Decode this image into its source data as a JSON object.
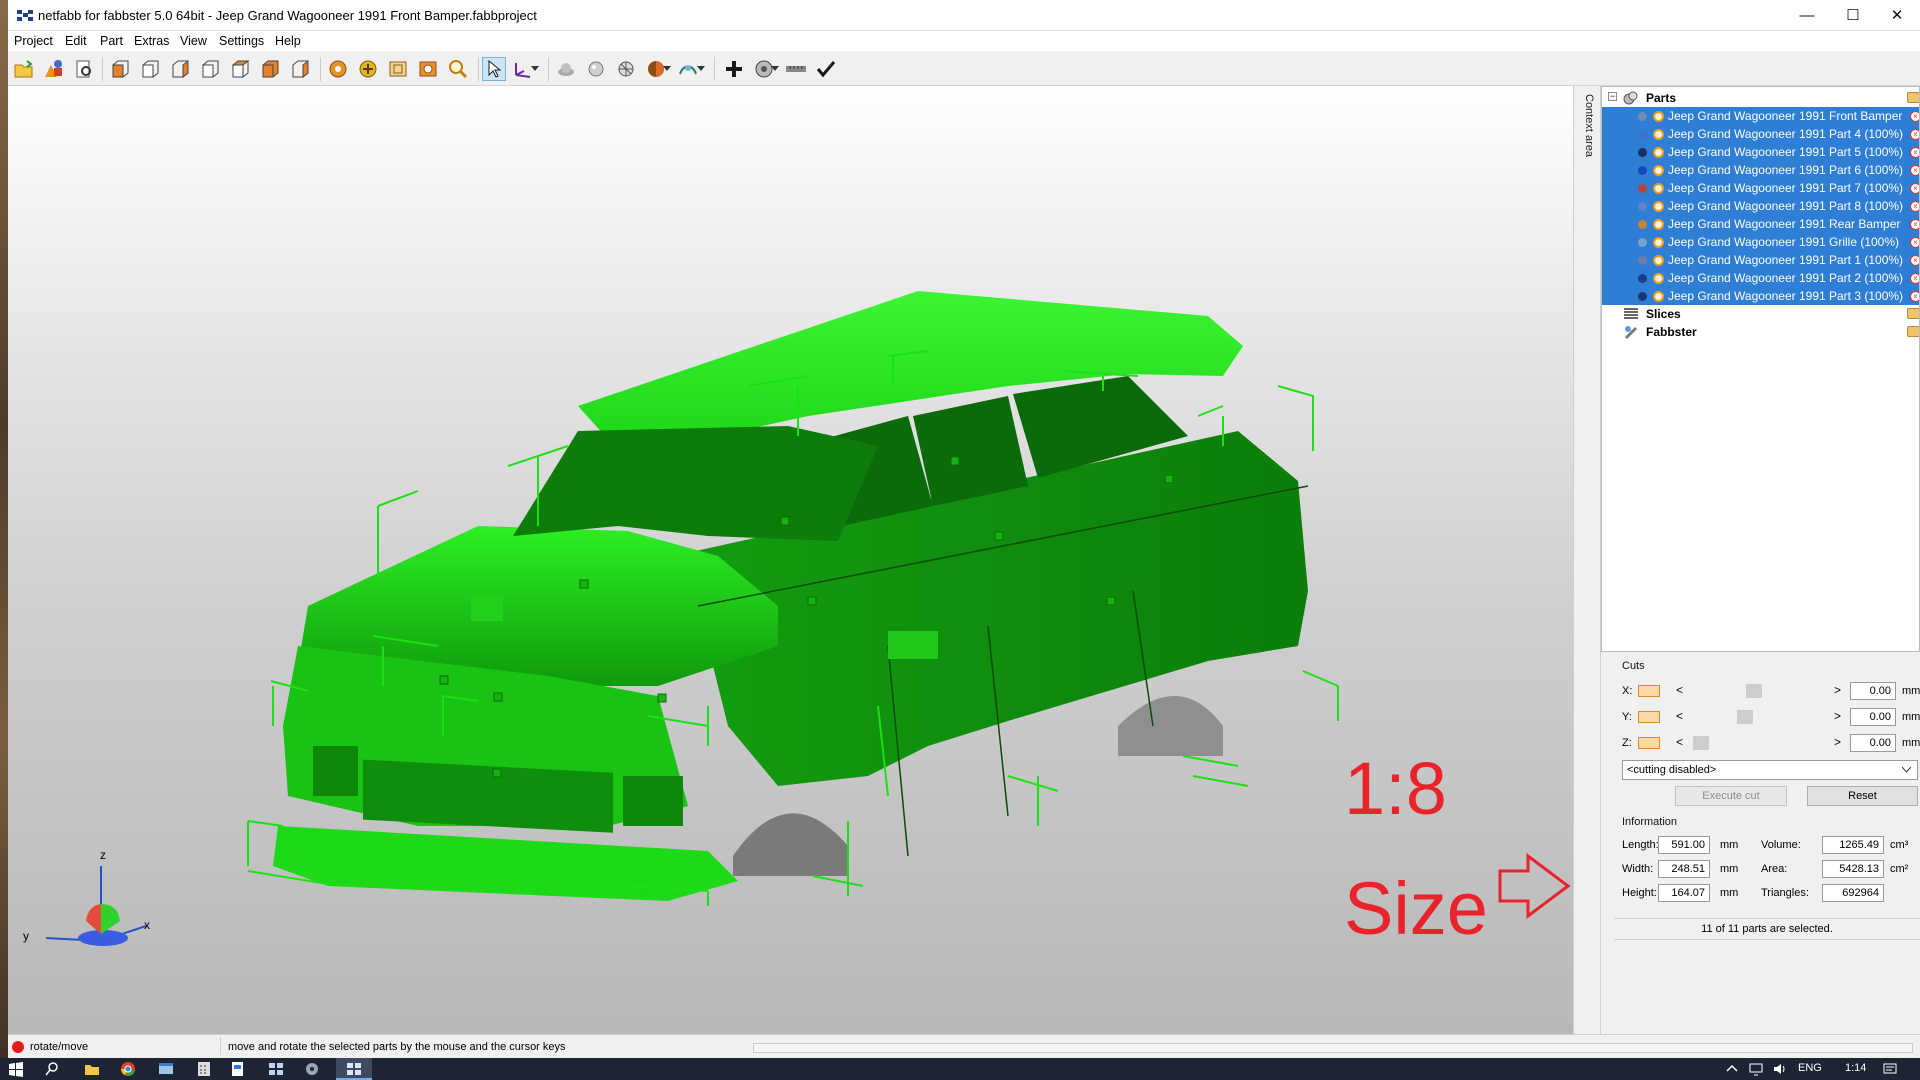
{
  "window": {
    "title": "netfabb for fabbster 5.0 64bit - Jeep Grand Wagooneer 1991 Front Bamper.fabbproject",
    "minimize": "—",
    "maximize": "☐",
    "close": "✕"
  },
  "menu": [
    "Project",
    "Edit",
    "Part",
    "Extras",
    "View",
    "Settings",
    "Help"
  ],
  "toolbar_icons": [
    "open-project",
    "add-part",
    "print-preview",
    "view-front",
    "view-back",
    "view-left",
    "view-right",
    "view-top",
    "view-bottom",
    "view-iso",
    "rotate-view",
    "pan-view",
    "zoom-window",
    "zoom-selection",
    "zoom",
    "select-pointer",
    "move-axis",
    "shade-flat",
    "shade-smooth",
    "mesh",
    "color-mode",
    "measure-mode",
    "add",
    "repair",
    "ruler",
    "apply-check"
  ],
  "viewport": {
    "axes": {
      "z": "z",
      "x": "x",
      "y": "y"
    },
    "annotation": {
      "scale": "1:8",
      "size": "Size"
    },
    "model_color": "#1fd81a"
  },
  "sidebar": {
    "context_tab": "Context area",
    "tree": {
      "parts_label": "Parts",
      "parts": [
        {
          "label": "Jeep Grand Wagooneer 1991 Front Bamper",
          "dot": "#6e8db7"
        },
        {
          "label": "Jeep Grand Wagooneer 1991 Part 4 (100%)",
          "dot": "#3c75c4"
        },
        {
          "label": "Jeep Grand Wagooneer 1991 Part 5 (100%)",
          "dot": "#1b2f5c"
        },
        {
          "label": "Jeep Grand Wagooneer 1991 Part 6 (100%)",
          "dot": "#1648b8"
        },
        {
          "label": "Jeep Grand Wagooneer 1991 Part 7 (100%)",
          "dot": "#b5453a"
        },
        {
          "label": "Jeep Grand Wagooneer 1991 Part 8 (100%)",
          "dot": "#5f86c4"
        },
        {
          "label": "Jeep Grand Wagooneer 1991 Rear Bamper",
          "dot": "#c8852b"
        },
        {
          "label": "Jeep Grand Wagooneer 1991 Grille (100%)",
          "dot": "#7aa1cf"
        },
        {
          "label": "Jeep Grand Wagooneer 1991 Part 1 (100%)",
          "dot": "#6a7fa6"
        },
        {
          "label": "Jeep Grand Wagooneer 1991 Part 2 (100%)",
          "dot": "#1f3e82"
        },
        {
          "label": "Jeep Grand Wagooneer 1991 Part 3 (100%)",
          "dot": "#163479"
        }
      ],
      "slices_label": "Slices",
      "fabbster_label": "Fabbster"
    },
    "cuts": {
      "title": "Cuts",
      "x_label": "X:",
      "y_label": "Y:",
      "z_label": "Z:",
      "x_value": "0.00",
      "y_value": "0.00",
      "z_value": "0.00",
      "x_slider": 0.62,
      "y_slider": 0.52,
      "z_slider": 0.05,
      "unit": "mm",
      "mode": "<cutting disabled>",
      "execute_label": "Execute cut",
      "reset_label": "Reset"
    },
    "info": {
      "title": "Information",
      "length_label": "Length:",
      "length_value": "591.00",
      "width_label": "Width:",
      "width_value": "248.51",
      "height_label": "Height:",
      "height_value": "164.07",
      "unit": "mm",
      "volume_label": "Volume:",
      "volume_value": "1265.49",
      "volume_unit": "cm³",
      "area_label": "Area:",
      "area_value": "5428.13",
      "area_unit": "cm²",
      "triangles_label": "Triangles:",
      "triangles_value": "692964"
    },
    "selection_status": "11 of 11 parts are selected."
  },
  "status": {
    "mode": "rotate/move",
    "hint": "move and rotate the selected parts by the mouse and the cursor keys"
  },
  "taskbar": {
    "lang": "ENG",
    "time": "1:14"
  }
}
